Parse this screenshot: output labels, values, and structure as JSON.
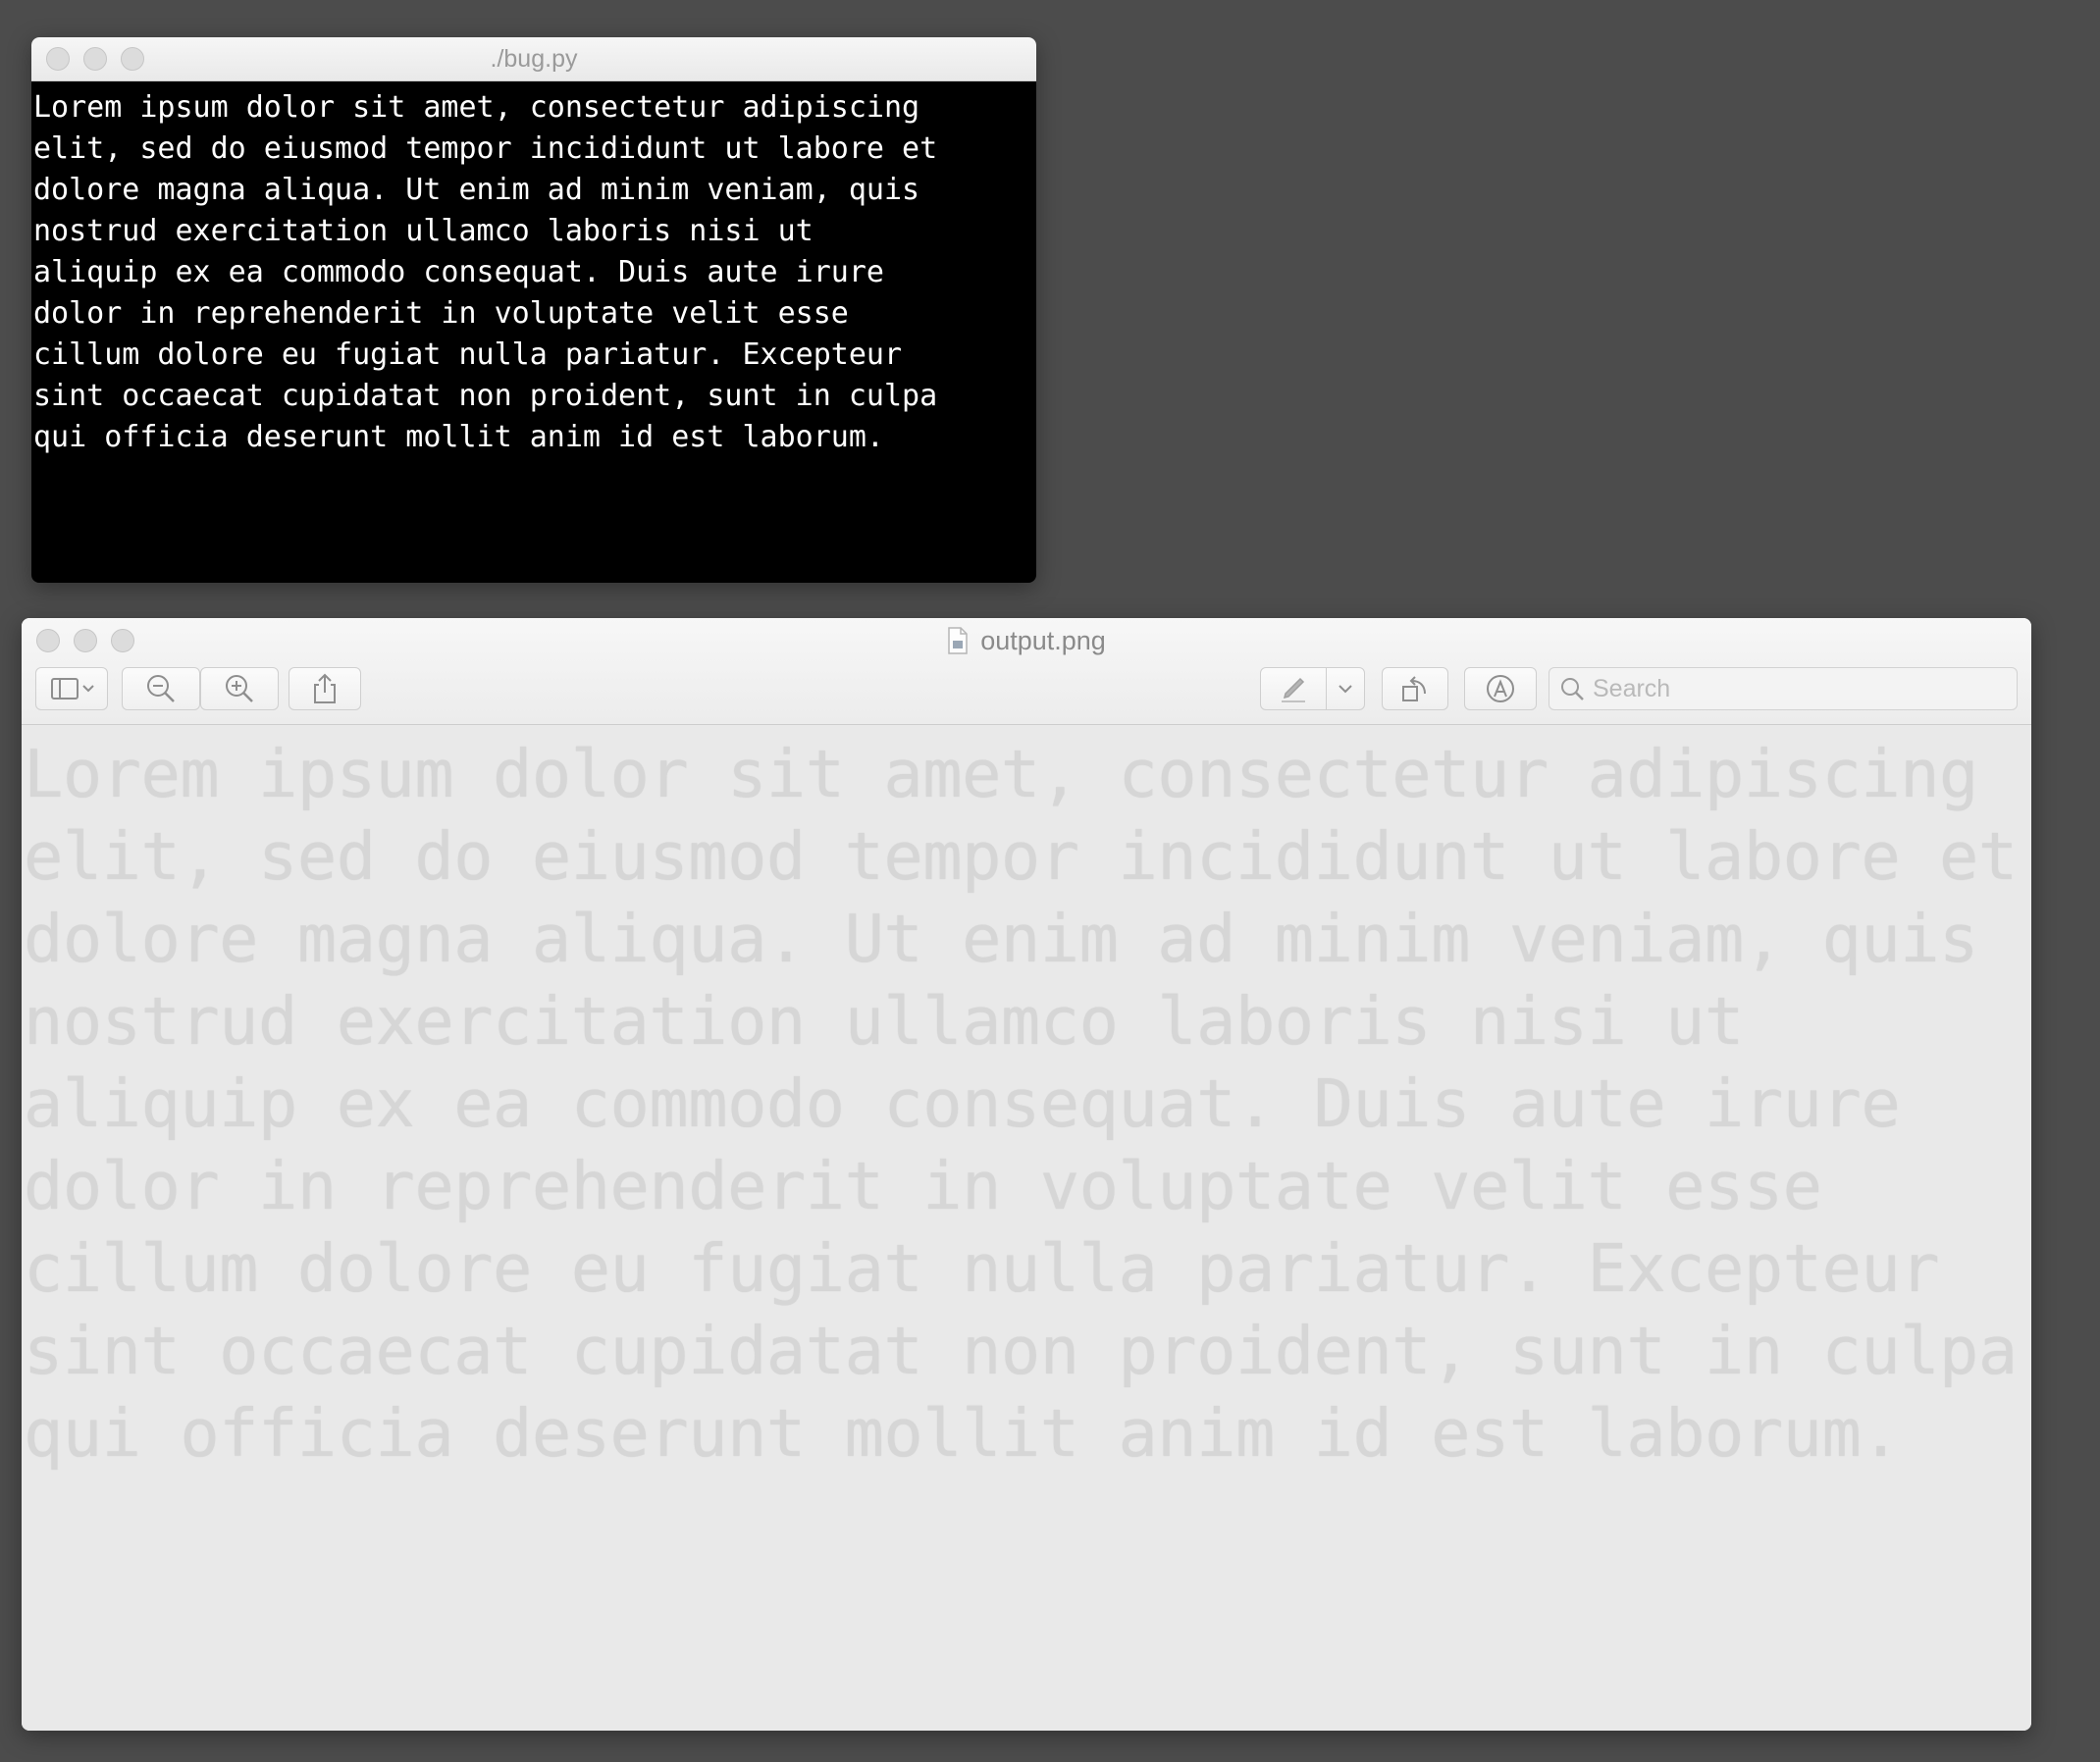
{
  "terminal": {
    "title": "./bug.py",
    "output": "Lorem ipsum dolor sit amet, consectetur adipiscing\nelit, sed do eiusmod tempor incididunt ut labore et\ndolore magna aliqua. Ut enim ad minim veniam, quis\nnostrud exercitation ullamco laboris nisi ut\naliquip ex ea commodo consequat. Duis aute irure\ndolor in reprehenderit in voluptate velit esse\ncillum dolore eu fugiat nulla pariatur. Excepteur\nsint occaecat cupidatat non proident, sunt in culpa\nqui officia deserunt mollit anim id est laborum."
  },
  "preview": {
    "title": "output.png",
    "toolbar": {
      "sidebar_icon": "sidebar-icon",
      "zoom_out_icon": "zoom-out-icon",
      "zoom_in_icon": "zoom-in-icon",
      "share_icon": "share-icon",
      "markup_pen_icon": "pen-icon",
      "rotate_icon": "rotate-icon",
      "annotate_icon": "annotate-icon"
    },
    "search": {
      "placeholder": "Search",
      "value": ""
    },
    "image_text": "Lorem ipsum dolor sit amet, consectetur adipiscing\nelit, sed do eiusmod tempor incididunt ut labore et\ndolore magna aliqua. Ut enim ad minim veniam, quis\nnostrud exercitation ullamco laboris nisi ut\naliquip ex ea commodo consequat. Duis aute irure\ndolor in reprehenderit in voluptate velit esse\ncillum dolore eu fugiat nulla pariatur. Excepteur\nsint occaecat cupidatat non proident, sunt in culpa\nqui officia deserunt mollit anim id est laborum."
  },
  "colors": {
    "desktop": "#4c4c4c",
    "terminal_bg": "#000000",
    "terminal_text": "#ffffff",
    "preview_bg": "#e9e9e9",
    "preview_text": "#d6d6d6"
  }
}
